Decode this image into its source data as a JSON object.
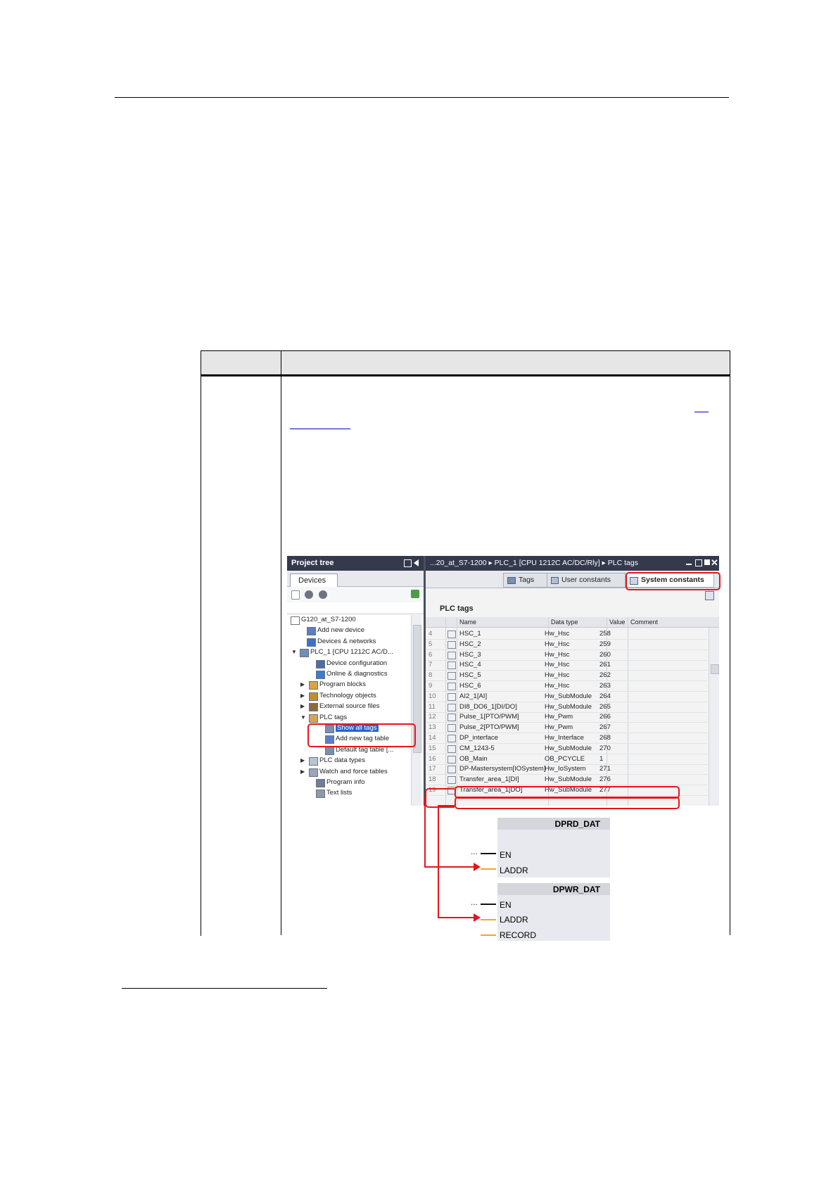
{
  "project_tree": {
    "title": "Project tree",
    "devices_tab": "Devices",
    "items": [
      {
        "label": "G120_at_S7-1200"
      },
      {
        "label": "Add new device"
      },
      {
        "label": "Devices & networks"
      },
      {
        "label": "PLC_1 [CPU 1212C AC/D..."
      },
      {
        "label": "Device configuration"
      },
      {
        "label": "Online & diagnostics"
      },
      {
        "label": "Program blocks"
      },
      {
        "label": "Technology objects"
      },
      {
        "label": "External source files"
      },
      {
        "label": "PLC tags"
      },
      {
        "label": "Show all tags"
      },
      {
        "label": "Add new tag table"
      },
      {
        "label": "Default tag table [..."
      },
      {
        "label": "PLC data types"
      },
      {
        "label": "Watch and force tables"
      },
      {
        "label": "Program info"
      },
      {
        "label": "Text lists"
      }
    ]
  },
  "editor": {
    "breadcrumb": "...20_at_S7-1200 ▸ PLC_1 [CPU 1212C AC/DC/Rly] ▸ PLC tags",
    "tabs": {
      "tags": "Tags",
      "user_constants": "User constants",
      "system_constants": "System constants"
    },
    "caption": "PLC tags",
    "columns": {
      "name": "Name",
      "data_type": "Data type",
      "value": "Value",
      "comment": "Comment"
    },
    "rows": [
      {
        "num": "4",
        "name": "HSC_1",
        "type": "Hw_Hsc",
        "value": "258"
      },
      {
        "num": "5",
        "name": "HSC_2",
        "type": "Hw_Hsc",
        "value": "259"
      },
      {
        "num": "6",
        "name": "HSC_3",
        "type": "Hw_Hsc",
        "value": "260"
      },
      {
        "num": "7",
        "name": "HSC_4",
        "type": "Hw_Hsc",
        "value": "261"
      },
      {
        "num": "8",
        "name": "HSC_5",
        "type": "Hw_Hsc",
        "value": "262"
      },
      {
        "num": "9",
        "name": "HSC_6",
        "type": "Hw_Hsc",
        "value": "263"
      },
      {
        "num": "10",
        "name": "AI2_1[AI]",
        "type": "Hw_SubModule",
        "value": "264"
      },
      {
        "num": "11",
        "name": "DI8_DO6_1[DI/DO]",
        "type": "Hw_SubModule",
        "value": "265"
      },
      {
        "num": "12",
        "name": "Pulse_1[PTO/PWM]",
        "type": "Hw_Pwm",
        "value": "266"
      },
      {
        "num": "13",
        "name": "Pulse_2[PTO/PWM]",
        "type": "Hw_Pwm",
        "value": "267"
      },
      {
        "num": "14",
        "name": "DP_interface",
        "type": "Hw_Interface",
        "value": "268"
      },
      {
        "num": "15",
        "name": "CM_1243-5",
        "type": "Hw_SubModule",
        "value": "270"
      },
      {
        "num": "16",
        "name": "OB_Main",
        "type": "OB_PCYCLE",
        "value": "1"
      },
      {
        "num": "17",
        "name": "DP-Mastersystem[IOSystem]",
        "type": "Hw_IoSystem",
        "value": "271"
      },
      {
        "num": "18",
        "name": "Transfer_area_1[DI]",
        "type": "Hw_SubModule",
        "value": "276"
      },
      {
        "num": "19",
        "name": "Transfer_area_1[DO]",
        "type": "Hw_SubModule",
        "value": "277"
      }
    ]
  },
  "blocks": {
    "dprd": {
      "title": "DPRD_DAT",
      "pins": [
        "EN",
        "LADDR"
      ]
    },
    "dpwr": {
      "title": "DPWR_DAT",
      "pins": [
        "EN",
        "LADDR",
        "RECORD"
      ]
    },
    "unconnected": "..."
  },
  "colors": {
    "highlight": "#e8141b",
    "titlebar": "#343a4c",
    "selection": "#2a62d4",
    "wire": "#f5a623"
  }
}
